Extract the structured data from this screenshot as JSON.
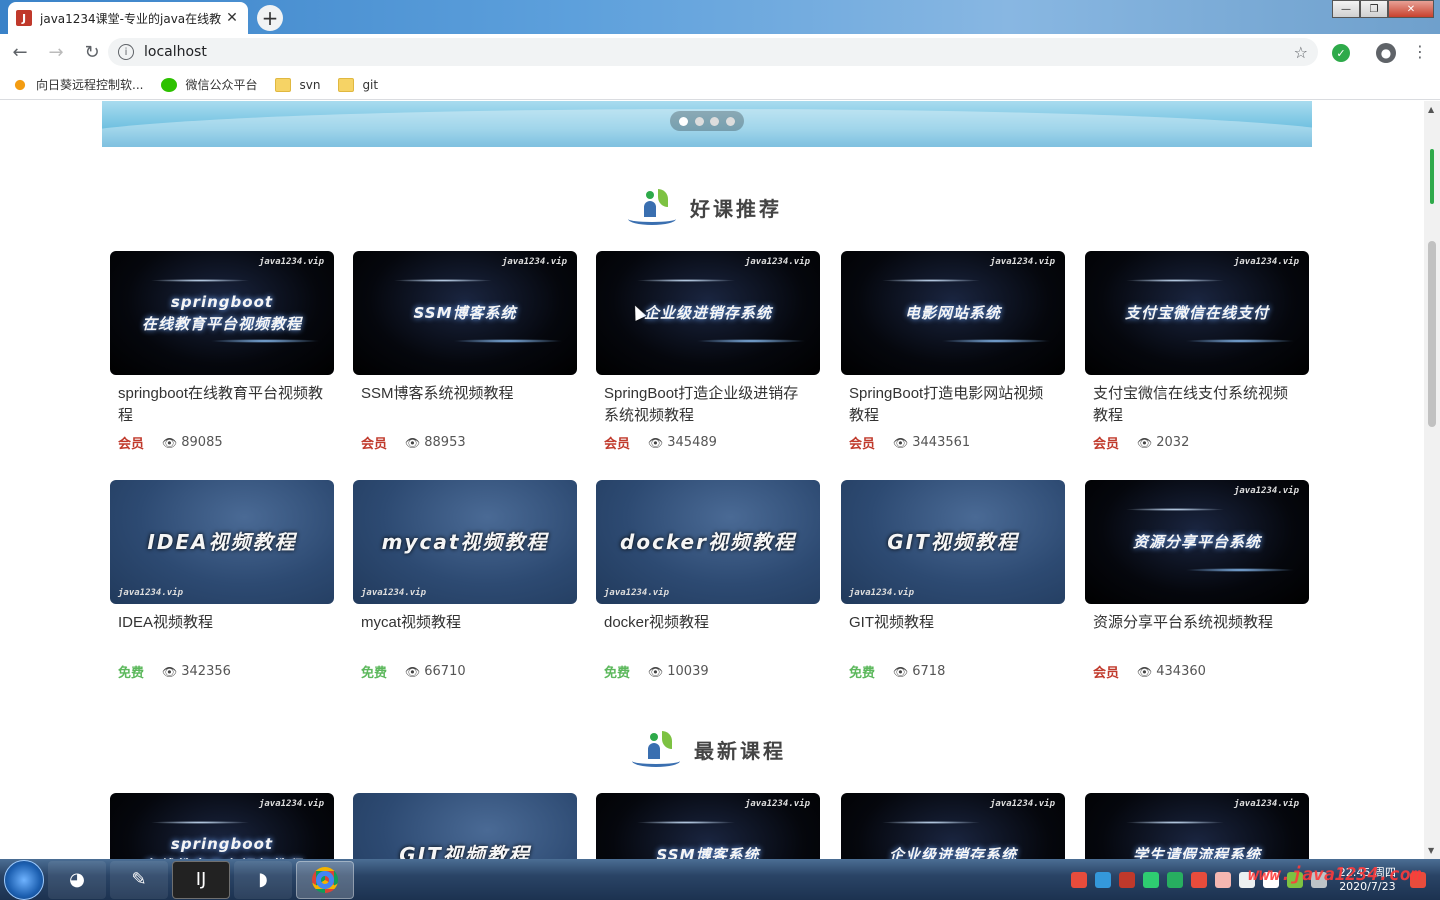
{
  "browser": {
    "tab_title": "java1234课堂-专业的java在线教",
    "tab_close": "✕",
    "new_tab": "+",
    "address": "localhost",
    "window_controls": [
      "—",
      "❐",
      "✕"
    ],
    "bookmarks": [
      {
        "label": "向日葵远程控制软...",
        "icon": "sunflower-icon"
      },
      {
        "label": "微信公众平台",
        "icon": "wechat-icon"
      },
      {
        "label": "svn",
        "icon": "folder-icon"
      },
      {
        "label": "git",
        "icon": "folder-icon"
      }
    ]
  },
  "banner": {
    "active_dot": 0,
    "dots": 4
  },
  "sections": {
    "recommended_title": "好课推荐",
    "latest_title": "最新课程"
  },
  "recommended": [
    {
      "thumb_title": "springboot\n在线教育平台视频教程",
      "style": "dark",
      "name": "springboot在线教育平台视频教程",
      "badge": "会员",
      "badge_type": "vip",
      "views": "89085"
    },
    {
      "thumb_title": "SSM博客系统",
      "style": "dark",
      "name": "SSM博客系统视频教程",
      "badge": "会员",
      "badge_type": "vip",
      "views": "88953"
    },
    {
      "thumb_title": "企业级进销存系统",
      "style": "dark",
      "name": "SpringBoot打造企业级进销存系统视频教程",
      "badge": "会员",
      "badge_type": "vip",
      "views": "345489"
    },
    {
      "thumb_title": "电影网站系统",
      "style": "dark",
      "name": "SpringBoot打造电影网站视频教程",
      "badge": "会员",
      "badge_type": "vip",
      "views": "3443561"
    },
    {
      "thumb_title": "支付宝微信在线支付",
      "style": "dark",
      "name": "支付宝微信在线支付系统视频教程",
      "badge": "会员",
      "badge_type": "vip",
      "views": "2032"
    },
    {
      "thumb_title": "IDEA视频教程",
      "style": "blue",
      "name": "IDEA视频教程",
      "badge": "免费",
      "badge_type": "free",
      "views": "342356"
    },
    {
      "thumb_title": "mycat视频教程",
      "style": "blue",
      "name": "mycat视频教程",
      "badge": "免费",
      "badge_type": "free",
      "views": "66710"
    },
    {
      "thumb_title": "docker视频教程",
      "style": "blue",
      "name": "docker视频教程",
      "badge": "免费",
      "badge_type": "free",
      "views": "10039"
    },
    {
      "thumb_title": "GIT视频教程",
      "style": "blue",
      "name": "GIT视频教程",
      "badge": "免费",
      "badge_type": "free",
      "views": "6718"
    },
    {
      "thumb_title": "资源分享平台系统",
      "style": "dark",
      "name": "资源分享平台系统视频教程",
      "badge": "会员",
      "badge_type": "vip",
      "views": "434360"
    }
  ],
  "latest": [
    {
      "thumb_title": "springboot\n在线教育平台视频教程",
      "style": "dark"
    },
    {
      "thumb_title": "GIT视频教程",
      "style": "blue"
    },
    {
      "thumb_title": "SSM博客系统",
      "style": "dark"
    },
    {
      "thumb_title": "企业级进销存系统",
      "style": "dark"
    },
    {
      "thumb_title": "学生请假流程系统",
      "style": "dark"
    }
  ],
  "thumb_brand": "java1234.vip",
  "taskbar": {
    "clock_time": "22:45 周四",
    "clock_date": "2020/7/23",
    "watermark": "www.java1234.com"
  },
  "colors": {
    "vip": "#c0392b",
    "free": "#5cb85c",
    "accent": "#3a6fb0"
  }
}
